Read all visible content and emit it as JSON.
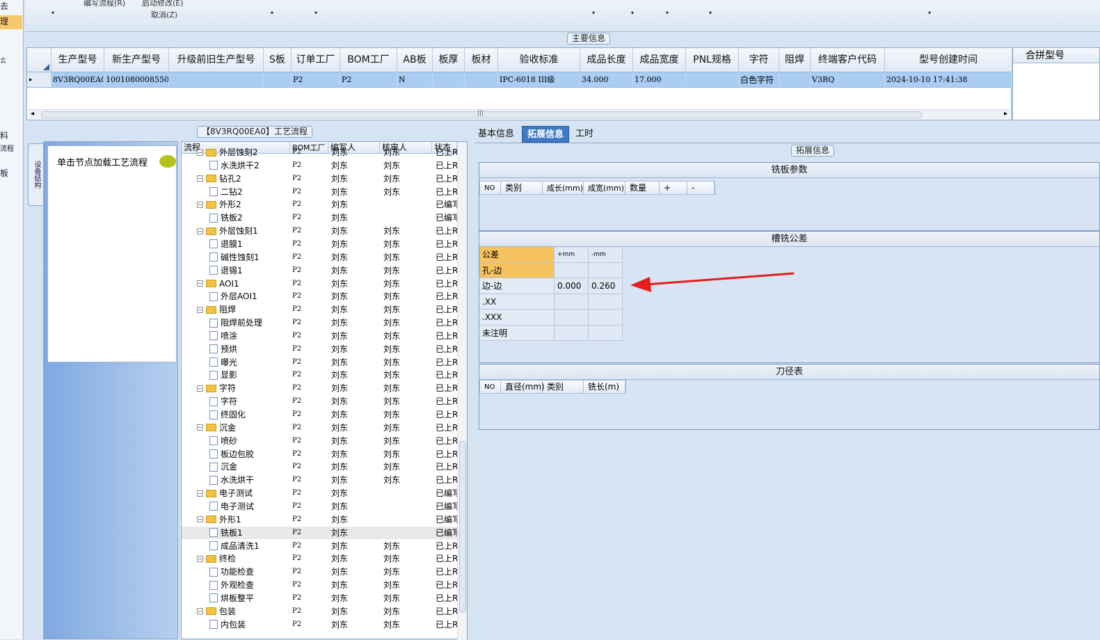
{
  "left_strip": {
    "items": [
      "去",
      "理",
      "ㄊ",
      "料",
      "流程",
      "板"
    ]
  },
  "toolbar": {
    "write_flow": "编写流程(R)",
    "start_modify": "启动修改(E)",
    "cancel": "取消(Z)",
    "dropdown_glyph": "▾"
  },
  "main_info": {
    "title": "主要信息",
    "columns": [
      "生产型号",
      "新生产型号",
      "升级前旧生产型号",
      "S板",
      "订单工厂",
      "BOM工厂",
      "AB板",
      "板厚",
      "板材",
      "验收标准",
      "成品长度",
      "成品宽度",
      "PNL规格",
      "字符",
      "阻焊",
      "终端客户代码",
      "型号创建时间"
    ],
    "row": [
      "8V3RQ00EA0",
      "10010800085508",
      "",
      "",
      "P2",
      "P2",
      "N",
      "",
      "",
      "IPC-6018 III级",
      "34.000",
      "17.000",
      "",
      "白色字符",
      "",
      "V3RQ",
      "2024-10-10 17:41:38"
    ],
    "row_marker": "▸",
    "scroll_left": "◂",
    "scroll_right": "▸",
    "scroll_grip": "|||"
  },
  "combo": {
    "title": "合拼型号"
  },
  "process": {
    "title": "【8V3RQ00EA0】工艺流程",
    "sidenav": "设备结构",
    "load_hint": "单击节点加载工艺流程",
    "columns": [
      "流程",
      "BOM工厂",
      "编写人",
      "核审人",
      "状态"
    ],
    "rows": [
      {
        "name": "外层蚀刻2",
        "level": 0,
        "bom": "P2",
        "writer": "刘东",
        "reviewer": "刘东",
        "status": "已上R"
      },
      {
        "name": "水洗烘干2",
        "level": 1,
        "bom": "P2",
        "writer": "刘东",
        "reviewer": "刘东",
        "status": "已上R"
      },
      {
        "name": "钻孔2",
        "level": 0,
        "bom": "P2",
        "writer": "刘东",
        "reviewer": "刘东",
        "status": "已上R"
      },
      {
        "name": "二钻2",
        "level": 1,
        "bom": "P2",
        "writer": "刘东",
        "reviewer": "刘东",
        "status": "已上R"
      },
      {
        "name": "外形2",
        "level": 0,
        "bom": "P2",
        "writer": "刘东",
        "reviewer": "",
        "status": "已编写"
      },
      {
        "name": "铣板2",
        "level": 1,
        "bom": "P2",
        "writer": "刘东",
        "reviewer": "",
        "status": "已编写"
      },
      {
        "name": "外层蚀刻1",
        "level": 0,
        "bom": "P2",
        "writer": "刘东",
        "reviewer": "刘东",
        "status": "已上R"
      },
      {
        "name": "退膜1",
        "level": 1,
        "bom": "P2",
        "writer": "刘东",
        "reviewer": "刘东",
        "status": "已上R"
      },
      {
        "name": "碱性蚀刻1",
        "level": 1,
        "bom": "P2",
        "writer": "刘东",
        "reviewer": "刘东",
        "status": "已上R"
      },
      {
        "name": "退锡1",
        "level": 1,
        "bom": "P2",
        "writer": "刘东",
        "reviewer": "刘东",
        "status": "已上R"
      },
      {
        "name": "AOI1",
        "level": 0,
        "bom": "P2",
        "writer": "刘东",
        "reviewer": "刘东",
        "status": "已上R"
      },
      {
        "name": "外层AOI1",
        "level": 1,
        "bom": "P2",
        "writer": "刘东",
        "reviewer": "刘东",
        "status": "已上R"
      },
      {
        "name": "阻焊",
        "level": 0,
        "bom": "P2",
        "writer": "刘东",
        "reviewer": "刘东",
        "status": "已上R"
      },
      {
        "name": "阻焊前处理",
        "level": 1,
        "bom": "P2",
        "writer": "刘东",
        "reviewer": "刘东",
        "status": "已上R"
      },
      {
        "name": "喷涂",
        "level": 1,
        "bom": "P2",
        "writer": "刘东",
        "reviewer": "刘东",
        "status": "已上R"
      },
      {
        "name": "预烘",
        "level": 1,
        "bom": "P2",
        "writer": "刘东",
        "reviewer": "刘东",
        "status": "已上R"
      },
      {
        "name": "曝光",
        "level": 1,
        "bom": "P2",
        "writer": "刘东",
        "reviewer": "刘东",
        "status": "已上R"
      },
      {
        "name": "显影",
        "level": 1,
        "bom": "P2",
        "writer": "刘东",
        "reviewer": "刘东",
        "status": "已上R"
      },
      {
        "name": "字符",
        "level": 0,
        "bom": "P2",
        "writer": "刘东",
        "reviewer": "刘东",
        "status": "已上R"
      },
      {
        "name": "字符",
        "level": 1,
        "bom": "P2",
        "writer": "刘东",
        "reviewer": "刘东",
        "status": "已上R"
      },
      {
        "name": "终固化",
        "level": 1,
        "bom": "P2",
        "writer": "刘东",
        "reviewer": "刘东",
        "status": "已上R"
      },
      {
        "name": "沉金",
        "level": 0,
        "bom": "P2",
        "writer": "刘东",
        "reviewer": "刘东",
        "status": "已上R"
      },
      {
        "name": "喷砂",
        "level": 1,
        "bom": "P2",
        "writer": "刘东",
        "reviewer": "刘东",
        "status": "已上R"
      },
      {
        "name": "板边包胶",
        "level": 1,
        "bom": "P2",
        "writer": "刘东",
        "reviewer": "刘东",
        "status": "已上R"
      },
      {
        "name": "沉金",
        "level": 1,
        "bom": "P2",
        "writer": "刘东",
        "reviewer": "刘东",
        "status": "已上R"
      },
      {
        "name": "水洗烘干",
        "level": 1,
        "bom": "P2",
        "writer": "刘东",
        "reviewer": "刘东",
        "status": "已上R"
      },
      {
        "name": "电子测试",
        "level": 0,
        "bom": "P2",
        "writer": "刘东",
        "reviewer": "",
        "status": "已编写"
      },
      {
        "name": "电子测试",
        "level": 1,
        "bom": "P2",
        "writer": "刘东",
        "reviewer": "",
        "status": "已编写"
      },
      {
        "name": "外形1",
        "level": 0,
        "bom": "P2",
        "writer": "刘东",
        "reviewer": "",
        "status": "已编写"
      },
      {
        "name": "铣板1",
        "level": 1,
        "bom": "P2",
        "writer": "刘东",
        "reviewer": "",
        "status": "已编写",
        "selected": true
      },
      {
        "name": "成品清洗1",
        "level": 1,
        "bom": "P2",
        "writer": "刘东",
        "reviewer": "刘东",
        "status": "已上R"
      },
      {
        "name": "终检",
        "level": 0,
        "bom": "P2",
        "writer": "刘东",
        "reviewer": "刘东",
        "status": "已上R"
      },
      {
        "name": "功能检查",
        "level": 1,
        "bom": "P2",
        "writer": "刘东",
        "reviewer": "刘东",
        "status": "已上R"
      },
      {
        "name": "外观检查",
        "level": 1,
        "bom": "P2",
        "writer": "刘东",
        "reviewer": "刘东",
        "status": "已上R"
      },
      {
        "name": "烘板整平",
        "level": 1,
        "bom": "P2",
        "writer": "刘东",
        "reviewer": "刘东",
        "status": "已上R"
      },
      {
        "name": "包装",
        "level": 0,
        "bom": "P2",
        "writer": "刘东",
        "reviewer": "刘东",
        "status": "已上R"
      },
      {
        "name": "内包装",
        "level": 1,
        "bom": "P2",
        "writer": "刘东",
        "reviewer": "刘东",
        "status": "已上R"
      }
    ]
  },
  "tabs": [
    "基本信息",
    "拓展信息",
    "工时"
  ],
  "active_tab": "拓展信息",
  "ext": {
    "title": "拓展信息",
    "milling_params": {
      "title": "铣板参数",
      "columns": [
        "NO",
        "类别",
        "成长(mm)",
        "成宽(mm)",
        "数量",
        "+",
        "-"
      ]
    },
    "slot_tolerance": {
      "title": "槽铣公差",
      "head": [
        "公差",
        "+mm",
        "-mm"
      ],
      "rows": [
        {
          "label": "孔-边",
          "plus": "",
          "minus": ""
        },
        {
          "label": "边-边",
          "plus": "0.000",
          "minus": "0.260"
        },
        {
          "label": ".XX",
          "plus": "",
          "minus": ""
        },
        {
          "label": ".XXX",
          "plus": "",
          "minus": ""
        },
        {
          "label": "未注明",
          "plus": "",
          "minus": ""
        }
      ]
    },
    "tool_table": {
      "title": "刀径表",
      "columns": [
        "NO",
        "直径(mm)",
        "类别",
        "铣长(m)"
      ]
    }
  },
  "colors": {
    "accent": "#3e79c4",
    "selected_row": "#a9cdf3",
    "highlight": "#f6c35f",
    "arrow": "#e41d1d"
  }
}
